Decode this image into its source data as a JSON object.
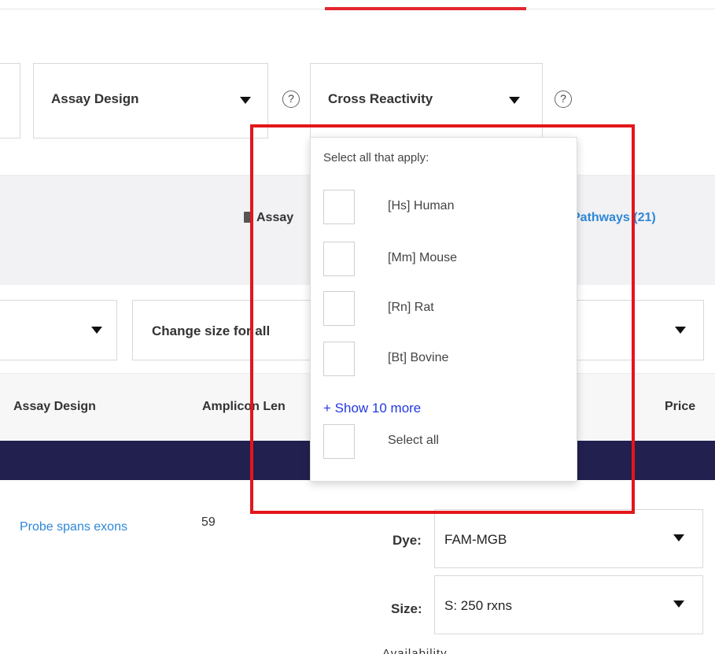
{
  "filters": {
    "assay_design": "Assay Design",
    "cross_reactivity": "Cross Reactivity",
    "help_glyph": "?"
  },
  "toolbar": {
    "assay_label": "Assay",
    "pathways_label": "Pathways (21)"
  },
  "size_select": {
    "label": "Change size for all"
  },
  "table": {
    "headers": [
      "Assay Design",
      "Amplicon Len",
      "Price"
    ]
  },
  "dropdown": {
    "prompt": "Select all that apply:",
    "options": [
      "[Hs] Human",
      "[Mm] Mouse",
      "[Rn] Rat",
      "[Bt] Bovine"
    ],
    "show_more": "+ Show 10 more",
    "select_all": "Select all"
  },
  "row": {
    "design_link": "Probe spans exons",
    "amplicon_length": "59",
    "dye_label": "Dye:",
    "dye_value": "FAM-MGB",
    "size_label": "Size:",
    "size_value": "S: 250 rxns",
    "availability_partial": "Availability"
  },
  "colors": {
    "accent_red": "#e3262d",
    "link_blue": "#2d87d8",
    "navy": "#22204f",
    "show_more_blue": "#2438e0"
  }
}
